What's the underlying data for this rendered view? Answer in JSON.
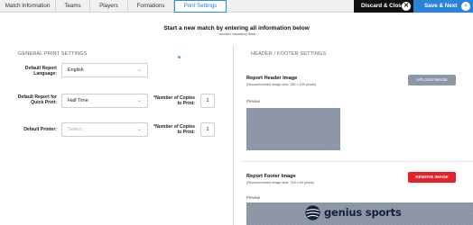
{
  "tabs": [
    {
      "label": "Match Information"
    },
    {
      "label": "Teams"
    },
    {
      "label": "Players"
    },
    {
      "label": "Formations"
    },
    {
      "label": "Print Settings"
    }
  ],
  "actions": {
    "discard_label": "Discard & Close",
    "save_label": "Save & Next"
  },
  "page": {
    "headline": "Start a new match by entering all information below",
    "subline": "* denotes mandatory fields"
  },
  "general": {
    "title": "GENERAL PRINT SETTINGS",
    "report_language_label": "Default Report Language:",
    "report_language_value": "English",
    "quick_print_label": "Default Report for Quick Print:",
    "quick_print_value": "Half Time",
    "printer_label": "Default Printer:",
    "printer_placeholder": "Select...",
    "copies_label_1": "*Number of Copies to Print:",
    "copies_value_1": "1",
    "copies_label_2": "*Number of Copies to Print:",
    "copies_value_2": "1"
  },
  "header_footer": {
    "title": "HEADER / FOOTER SETTINGS",
    "header_title": "Report Header Image",
    "header_sub": "(Recommended image size: 250 x 150 pixels)",
    "upload_label": "UPLOAD IMAGE",
    "preview_label": "Preview",
    "footer_title": "Report Footer Image",
    "footer_sub": "(Recommended image size: 718 x 65 pixels)",
    "remove_label": "REMOVE IMAGE",
    "footer_preview_label": "Preview",
    "logo_text": "genius sports"
  },
  "colors": {
    "accent": "#2b84d8",
    "danger": "#e8202a",
    "dark": "#111111",
    "preview_bg": "#8a94a4"
  }
}
